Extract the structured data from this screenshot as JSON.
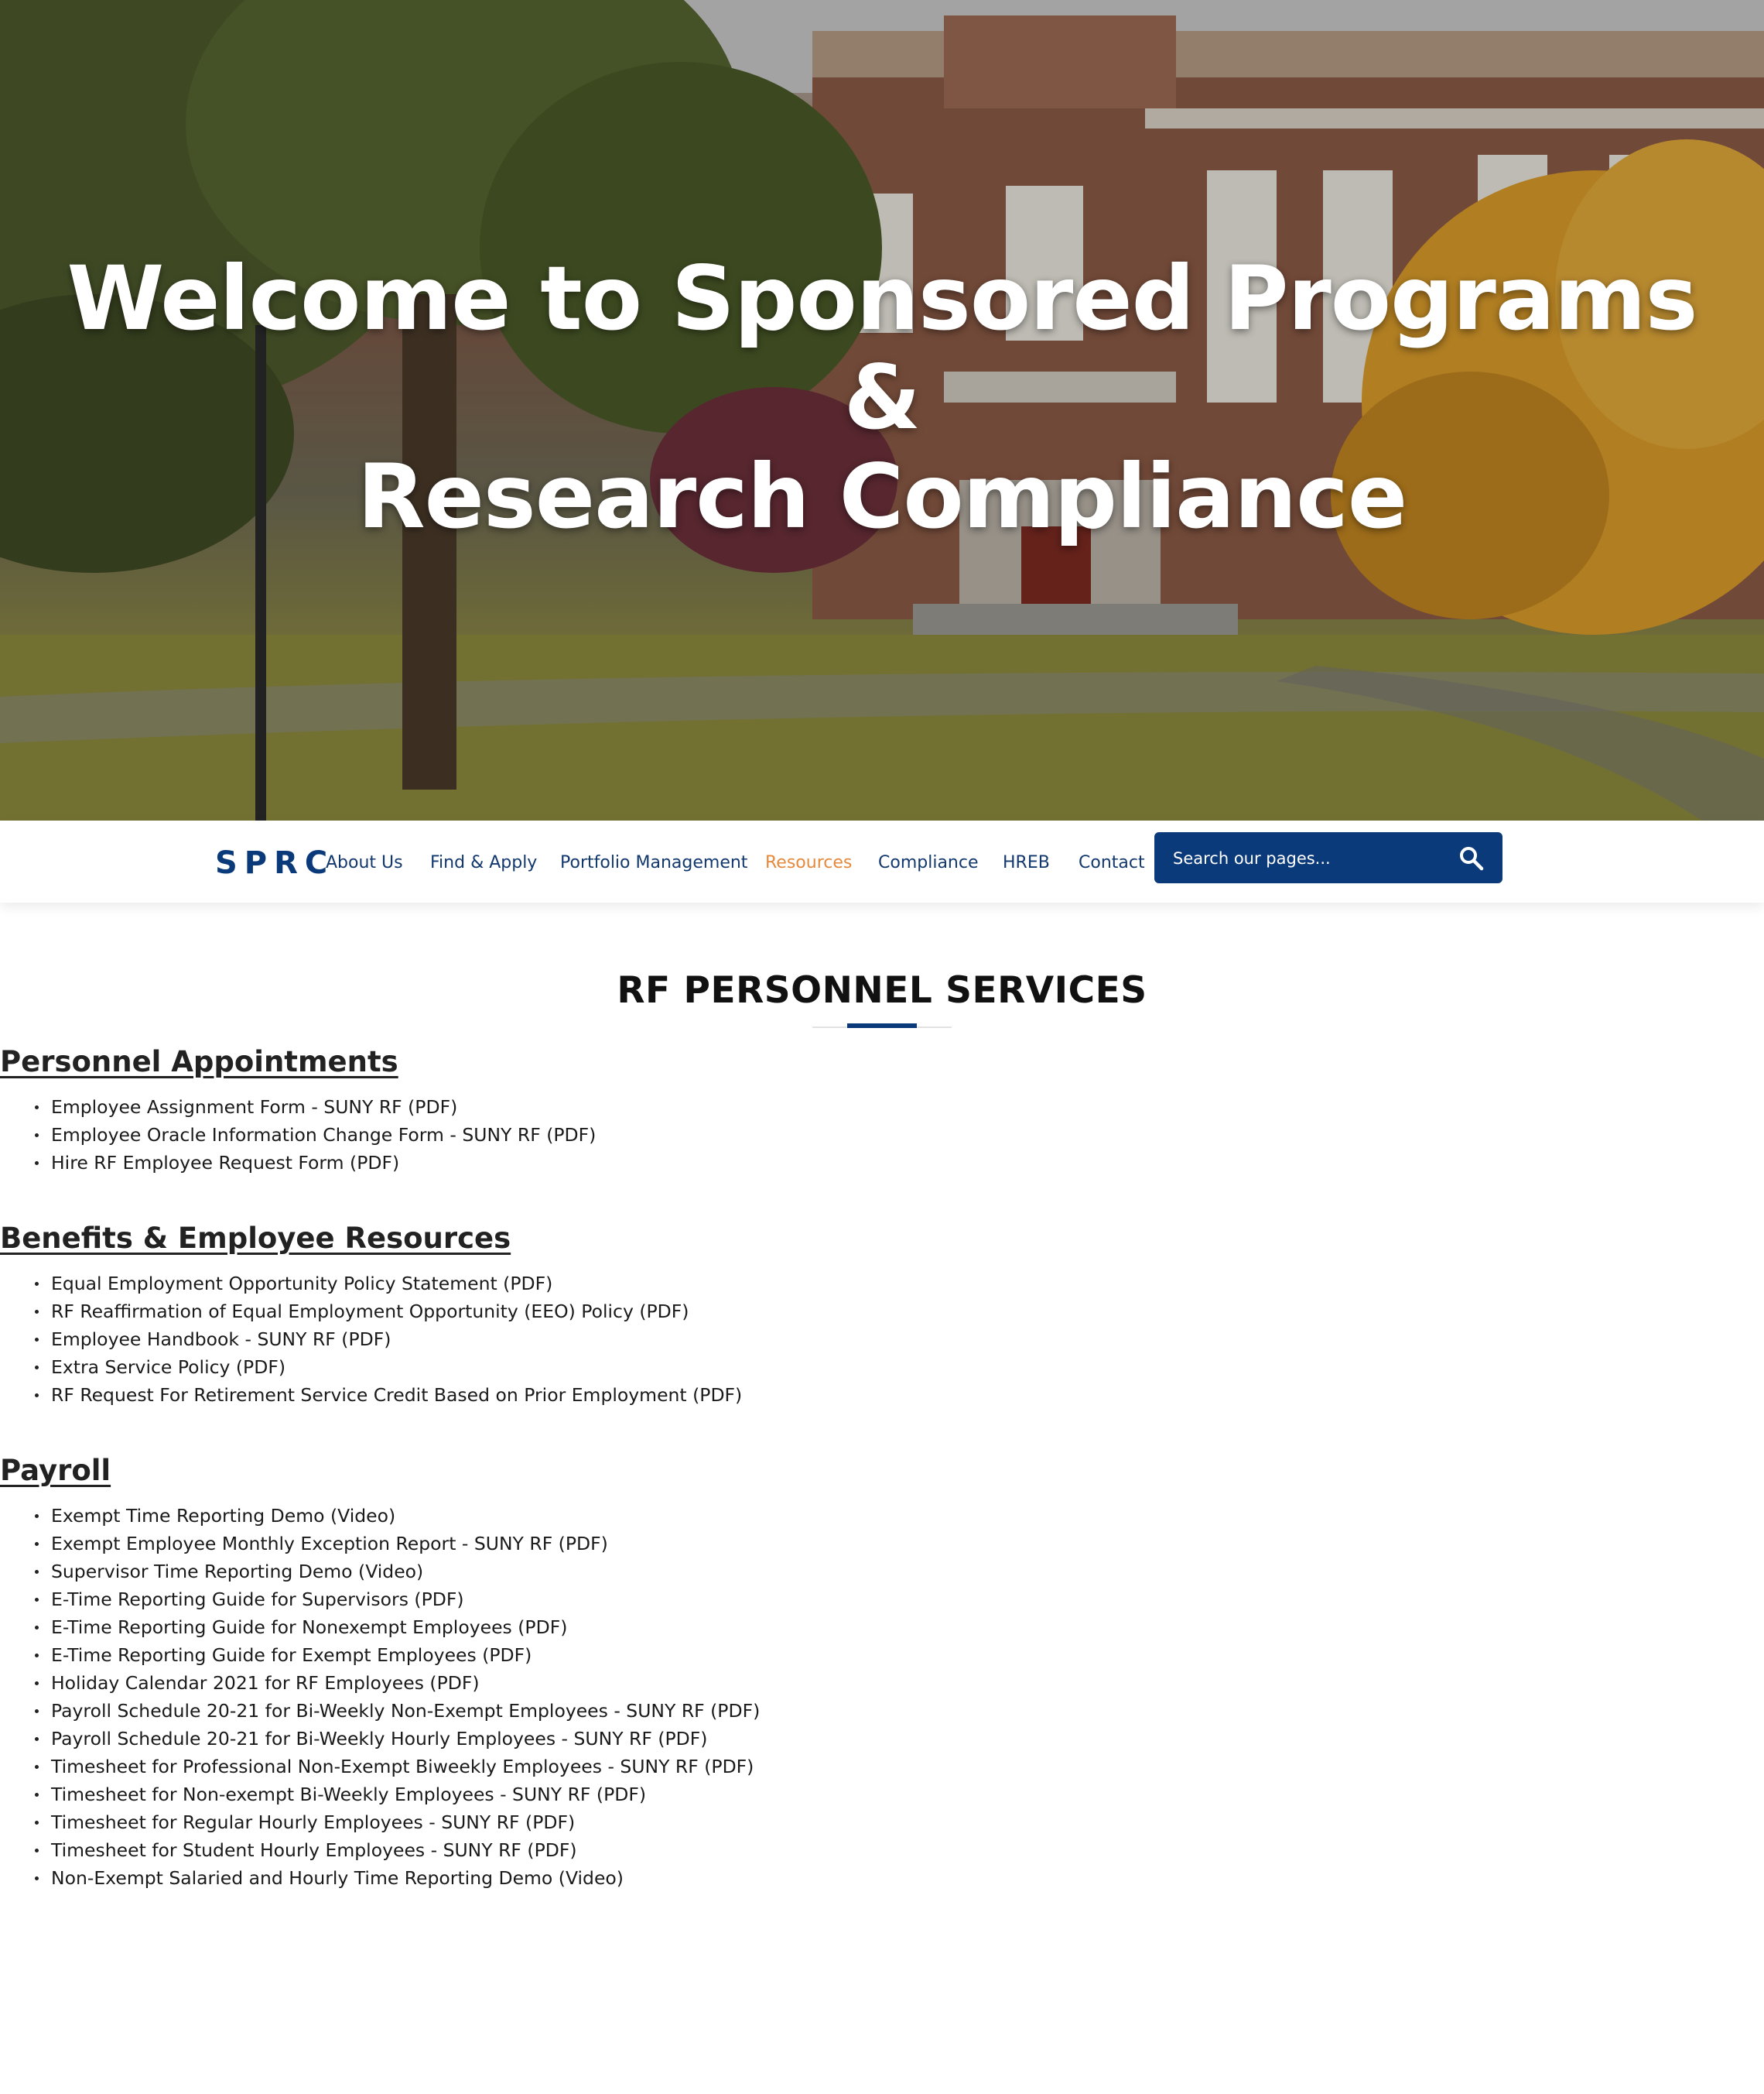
{
  "hero": {
    "title_line1": "Welcome to Sponsored Programs",
    "title_line2": "&",
    "title_line3": "Research Compliance"
  },
  "nav": {
    "brand": "SPRC",
    "items": [
      {
        "label": "About Us"
      },
      {
        "label": "Find & Apply"
      },
      {
        "label": "Portfolio Management"
      },
      {
        "label": "Resources",
        "active": true
      },
      {
        "label": "Compliance"
      },
      {
        "label": "HREB"
      },
      {
        "label": "Contact"
      }
    ],
    "search_placeholder": "Search our pages...",
    "search_icon": "search-icon"
  },
  "colors": {
    "brand_navy": "#0b3a7a",
    "active_orange": "#e58a3c",
    "text": "#1a1a1a"
  },
  "main": {
    "title": "RF PERSONNEL SERVICES",
    "sections": [
      {
        "heading": "Personnel Appointments",
        "items": [
          "Employee Assignment Form - SUNY RF (PDF)",
          "Employee Oracle Information Change Form - SUNY RF (PDF)",
          "Hire RF Employee Request Form (PDF)"
        ]
      },
      {
        "heading": "Benefits & Employee Resources",
        "items": [
          "Equal Employment Opportunity Policy Statement (PDF)",
          "RF Reaffirmation of Equal Employment Opportunity (EEO) Policy (PDF)",
          "Employee Handbook - SUNY RF (PDF)",
          "Extra Service Policy (PDF)",
          "RF Request For Retirement Service Credit Based on Prior Employment (PDF)"
        ]
      },
      {
        "heading": "Payroll",
        "items": [
          "Exempt Time Reporting Demo (Video)",
          "Exempt Employee Monthly Exception Report - SUNY RF (PDF)",
          "Supervisor Time Reporting Demo (Video)",
          "E-Time Reporting Guide for Supervisors (PDF)",
          "E-Time Reporting Guide for Nonexempt Employees (PDF)",
          "E-Time Reporting Guide for Exempt Employees (PDF)",
          "Holiday Calendar 2021 for RF Employees (PDF)",
          "Payroll Schedule 20-21 for Bi-Weekly Non-Exempt Employees - SUNY RF (PDF)",
          "Payroll Schedule 20-21 for Bi-Weekly Hourly Employees - SUNY RF (PDF)",
          "Timesheet for Professional Non-Exempt Biweekly Employees - SUNY RF (PDF)",
          "Timesheet for Non-exempt Bi-Weekly Employees - SUNY RF (PDF)",
          "Timesheet for Regular Hourly Employees - SUNY RF (PDF)",
          "Timesheet for Student Hourly Employees - SUNY RF (PDF)",
          "Non-Exempt Salaried and Hourly Time Reporting Demo (Video)"
        ]
      }
    ]
  }
}
